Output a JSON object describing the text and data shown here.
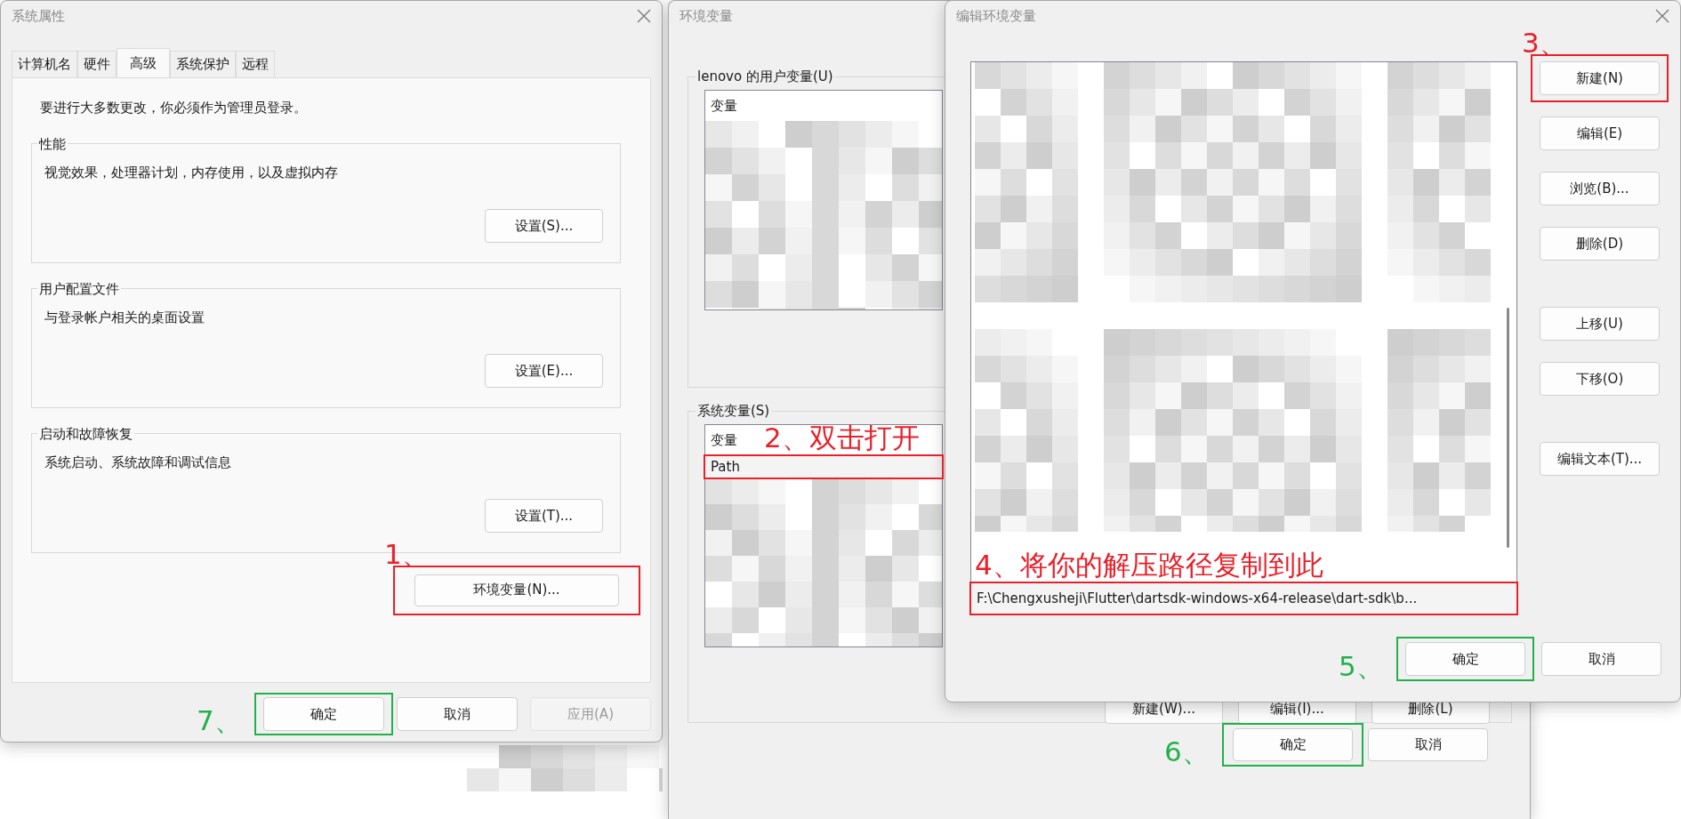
{
  "system_properties": {
    "title": "系统属性",
    "tabs": [
      {
        "label": "计算机名",
        "selected": false
      },
      {
        "label": "硬件",
        "selected": false
      },
      {
        "label": "高级",
        "selected": true
      },
      {
        "label": "系统保护",
        "selected": false
      },
      {
        "label": "远程",
        "selected": false
      }
    ],
    "notice": "要进行大多数更改，你必须作为管理员登录。",
    "groups": [
      {
        "label": "性能",
        "description": "视觉效果，处理器计划，内存使用，以及虚拟内存",
        "button": "设置(S)..."
      },
      {
        "label": "用户配置文件",
        "description": "与登录帐户相关的桌面设置",
        "button": "设置(E)..."
      },
      {
        "label": "启动和故障恢复",
        "description": "系统启动、系统故障和调试信息",
        "button": "设置(T)..."
      }
    ],
    "env_button": {
      "label": "环境变量(N)...",
      "annotation": {
        "text": "1、",
        "color": "#e8202a"
      }
    },
    "buttons": [
      {
        "label": "确定",
        "disabled": false,
        "annotation": {
          "text": "7、",
          "color": "#22b04b"
        }
      },
      {
        "label": "取消",
        "disabled": false
      },
      {
        "label": "应用(A)",
        "disabled": true
      }
    ]
  },
  "environment_variables": {
    "title": "环境变量",
    "user_group": {
      "label": "lenovo 的用户变量(U)",
      "header": "变量"
    },
    "system_group": {
      "label": "系统变量(S)",
      "header": "变量",
      "row": "Path",
      "annotation": {
        "text": "2、双击打开",
        "color": "#e8202a"
      },
      "buttons": [
        "新建(W)...",
        "编辑(I)...",
        "删除(L)"
      ]
    },
    "buttons": [
      {
        "label": "确定",
        "annotation": {
          "text": "6、",
          "color": "#22b04b"
        }
      },
      {
        "label": "取消"
      }
    ]
  },
  "edit_variable": {
    "title": "编辑环境变量",
    "path_entry": {
      "text": "F:\\Chengxusheji\\Flutter\\dartsdk-windows-x64-release\\dart-sdk\\b...",
      "annotation": {
        "text": "4、将你的解压路径复制到此",
        "color": "#e8202a"
      }
    },
    "button_groups": [
      [
        {
          "label": "新建(N)",
          "annotation": {
            "text": "3、",
            "color": "#e8202a"
          }
        },
        {
          "label": "编辑(E)"
        },
        {
          "label": "浏览(B)..."
        },
        {
          "label": "删除(D)"
        }
      ],
      [
        {
          "label": "上移(U)"
        },
        {
          "label": "下移(O)"
        }
      ],
      [
        {
          "label": "编辑文本(T)..."
        }
      ]
    ],
    "buttons": [
      {
        "label": "确定",
        "annotation": {
          "text": "5、",
          "color": "#22b04b"
        }
      },
      {
        "label": "取消"
      }
    ]
  }
}
